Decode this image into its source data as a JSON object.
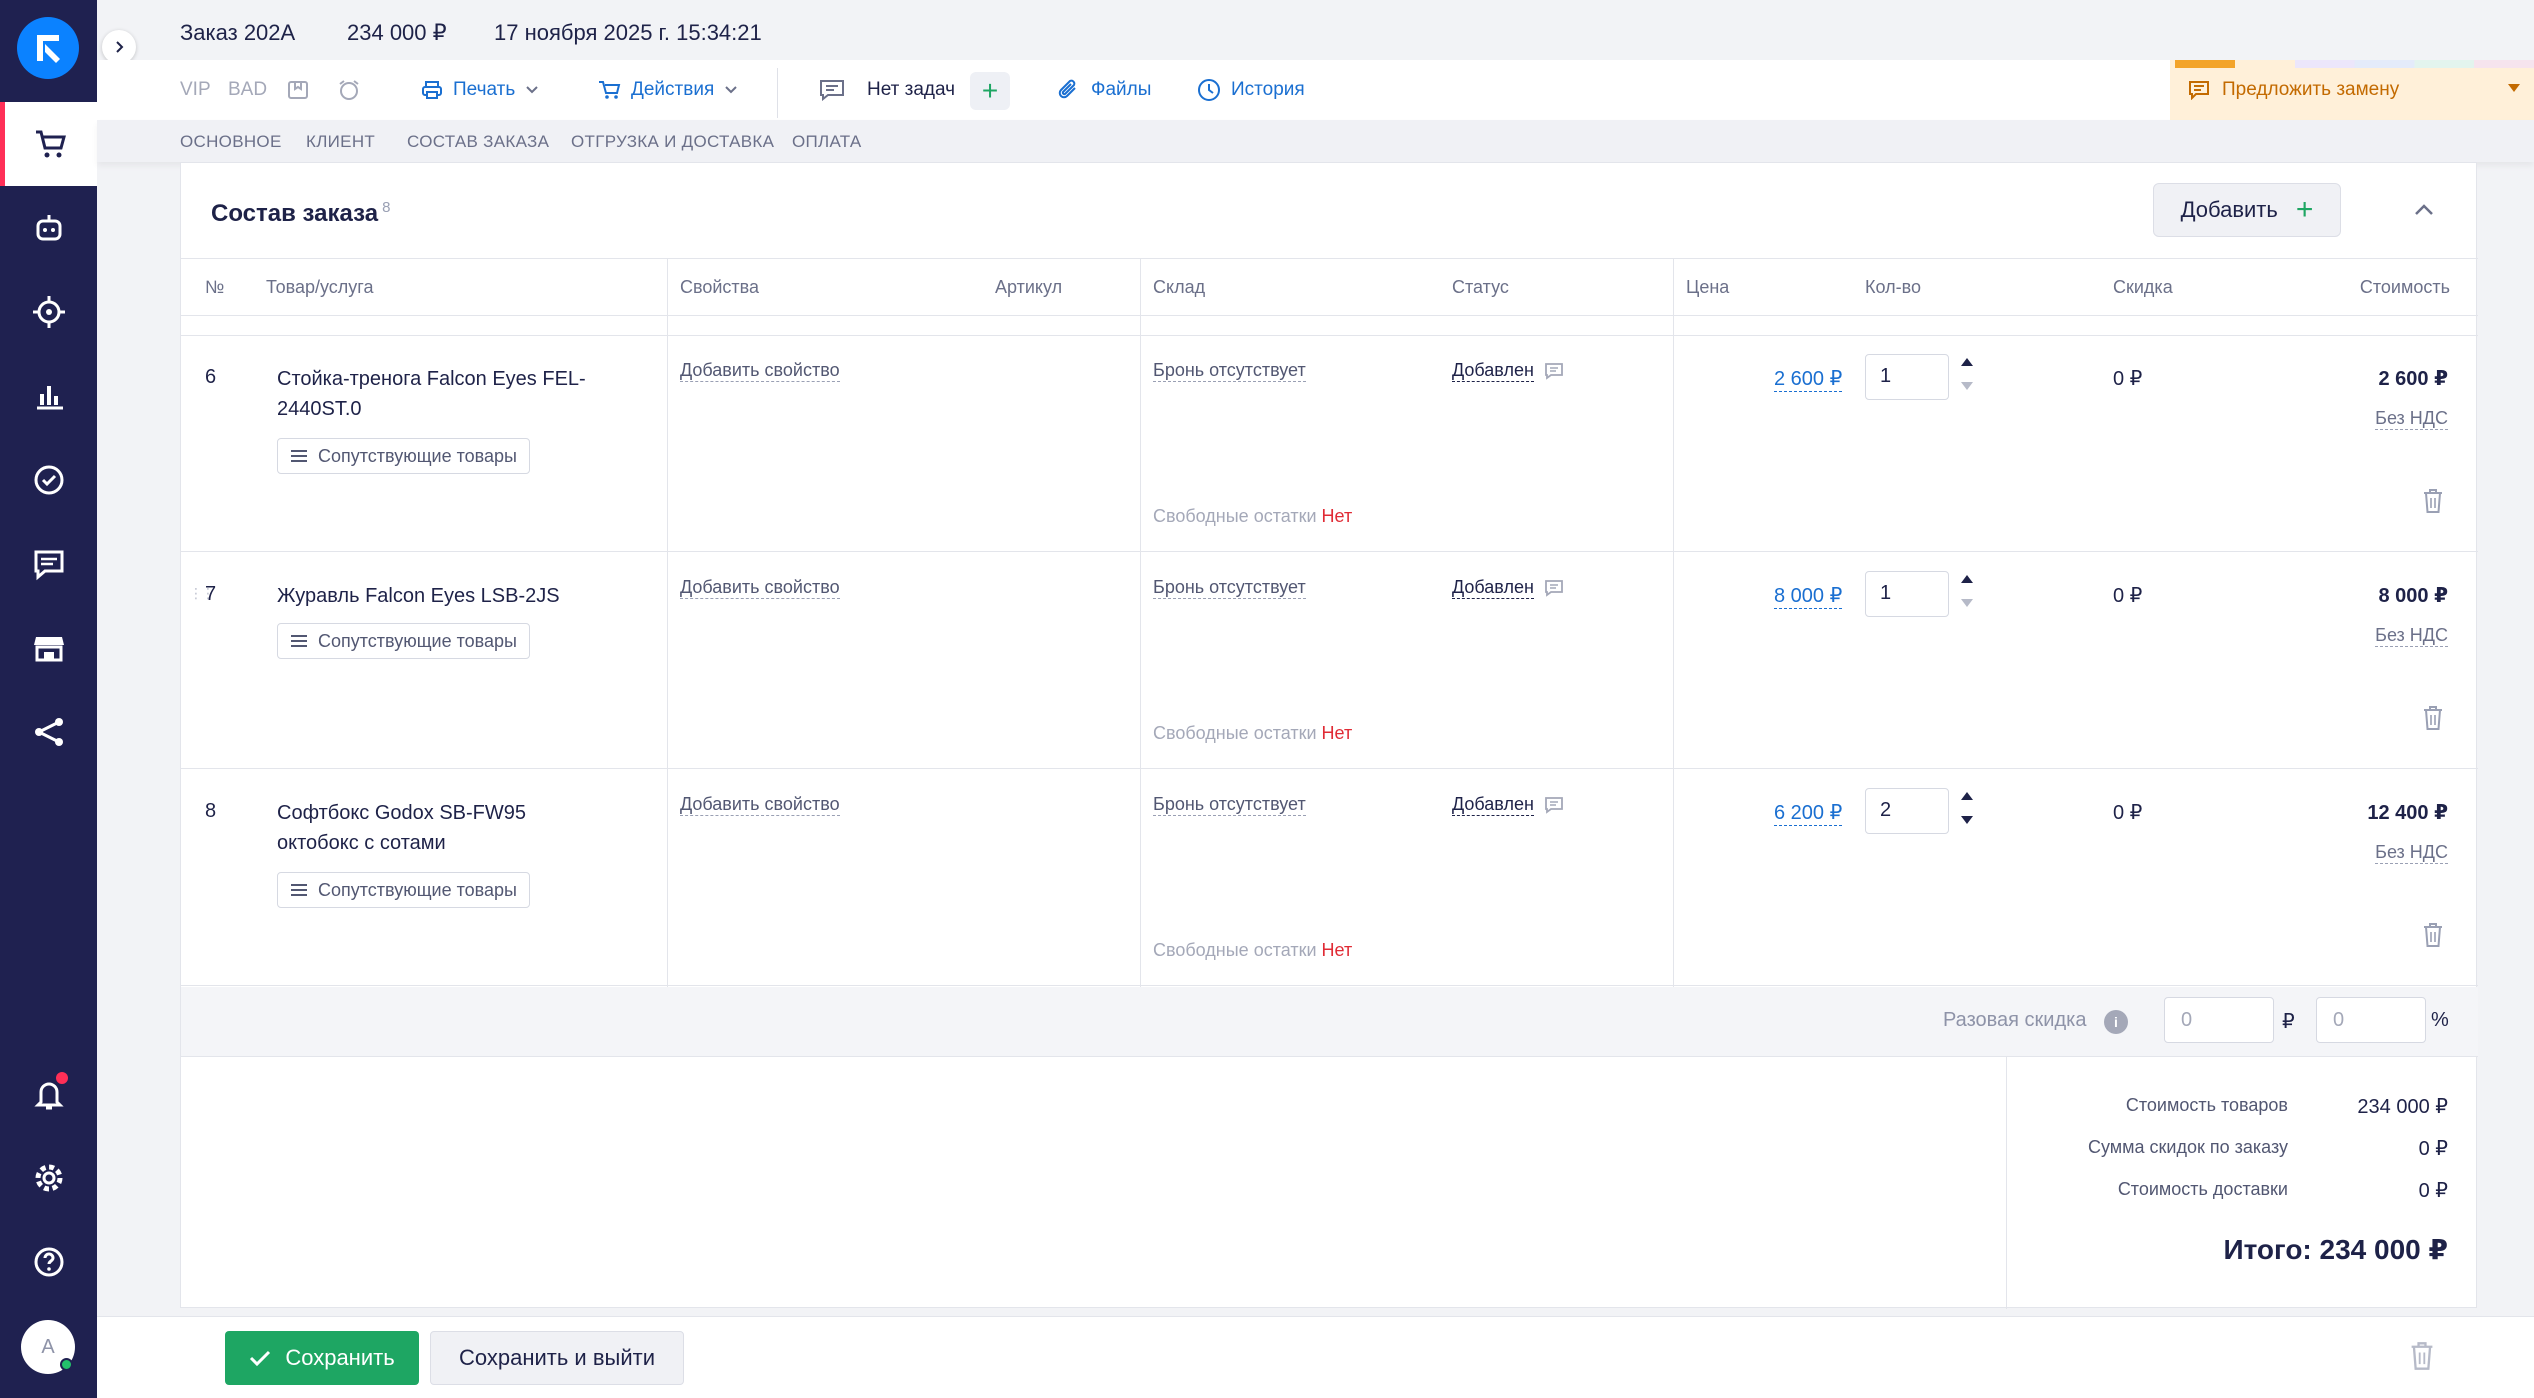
{
  "header": {
    "order_title": "Заказ 202А",
    "order_sum": "234 000 ₽",
    "order_date": "17 ноября 2025 г. 15:34:21"
  },
  "toolbar": {
    "vip": "VIP",
    "bad": "BAD",
    "print_label": "Печать",
    "actions_label": "Действия",
    "tasks_label": "Нет задач",
    "add_task_label": "+",
    "files_label": "Файлы",
    "history_label": "История",
    "suggest_label": "Предложить замену"
  },
  "tabs": [
    "ОСНОВНОЕ",
    "КЛИЕНТ",
    "СОСТАВ ЗАКАЗА",
    "ОТГРУЗКА И ДОСТАВКА",
    "ОПЛАТА"
  ],
  "composition": {
    "title": "Состав заказа",
    "count": "8",
    "add_label": "Добавить",
    "add_plus": "+",
    "columns": {
      "no": "№",
      "product": "Товар/услуга",
      "props": "Свойства",
      "sku": "Артикул",
      "stock": "Склад",
      "status": "Статус",
      "price": "Цена",
      "qty": "Кол-во",
      "discount": "Скидка",
      "cost": "Стоимость"
    },
    "rows": [
      {
        "no": "6",
        "name": "Стойка-тренога Falcon Eyes FEL-2440ST.0",
        "related": "Сопутствующие товары",
        "add_prop": "Добавить свойство",
        "reserve": "Бронь отсутствует",
        "free_label": "Свободные остатки",
        "free_value": "Нет",
        "status": "Добавлен",
        "price": "2 600 ₽",
        "qty": "1",
        "discount": "0 ₽",
        "cost": "2 600 ₽",
        "vat": "Без НДС"
      },
      {
        "no": "7",
        "name": "Журавль Falcon Eyes LSB-2JS",
        "related": "Сопутствующие товары",
        "add_prop": "Добавить свойство",
        "reserve": "Бронь отсутствует",
        "free_label": "Свободные остатки",
        "free_value": "Нет",
        "status": "Добавлен",
        "price": "8 000 ₽",
        "qty": "1",
        "discount": "0 ₽",
        "cost": "8 000 ₽",
        "vat": "Без НДС"
      },
      {
        "no": "8",
        "name": "Софтбокс Godox SB-FW95 октобокс с сотами",
        "related": "Сопутствующие товары",
        "add_prop": "Добавить свойство",
        "reserve": "Бронь отсутствует",
        "free_label": "Свободные остатки",
        "free_value": "Нет",
        "status": "Добавлен",
        "price": "6 200 ₽",
        "qty": "2",
        "discount": "0 ₽",
        "cost": "12 400 ₽",
        "vat": "Без НДС"
      }
    ],
    "one_time_discount": {
      "label": "Разовая скидка",
      "info": "i",
      "amount_placeholder": "0",
      "amount_unit": "₽",
      "percent_placeholder": "0",
      "percent_unit": "%"
    },
    "totals": {
      "goods_label": "Стоимость товаров",
      "goods_value": "234 000 ₽",
      "discounts_label": "Сумма скидок по заказу",
      "discounts_value": "0 ₽",
      "delivery_label": "Стоимость доставки",
      "delivery_value": "0 ₽",
      "total": "Итого: 234 000 ₽"
    }
  },
  "footer": {
    "save_label": "Сохранить",
    "save_exit_label": "Сохранить и выйти"
  },
  "user": {
    "avatar_letter": "A"
  },
  "colors": {
    "sidebar": "#1f2150",
    "accent_blue": "#1a6fd1",
    "accent_green": "#1ea663",
    "danger": "#e02b35",
    "warning_bg": "#fff0d9"
  }
}
